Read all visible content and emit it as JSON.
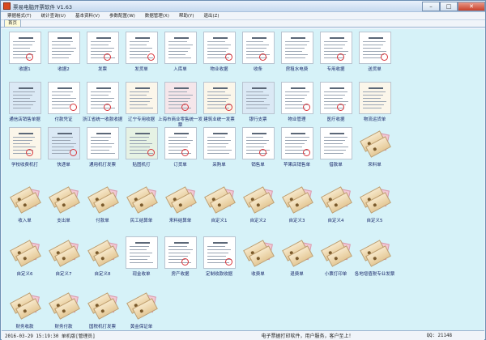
{
  "window": {
    "title": "票易电脑开票软件 V1.63",
    "min_icon": "minimize-icon",
    "max_icon": "maximize-icon",
    "close_icon": "close-icon"
  },
  "menu": [
    {
      "label": "票据格式(T)"
    },
    {
      "label": "统计查询(U)"
    },
    {
      "label": "基本资料(V)"
    },
    {
      "label": "参数配置(W)"
    },
    {
      "label": "数据管理(X)"
    },
    {
      "label": "帮助(Y)"
    },
    {
      "label": "退出(Z)"
    }
  ],
  "tabs": [
    {
      "label": "首页"
    }
  ],
  "tiles": [
    {
      "label": "收据1",
      "style": "doc"
    },
    {
      "label": "收据2",
      "style": "doc"
    },
    {
      "label": "发票",
      "style": "doc"
    },
    {
      "label": "发货单",
      "style": "doc"
    },
    {
      "label": "入库单",
      "style": "doc"
    },
    {
      "label": "物业收据",
      "style": "doc"
    },
    {
      "label": "收条",
      "style": "doc"
    },
    {
      "label": "房租水电费",
      "style": "doc"
    },
    {
      "label": "专用收据",
      "style": "doc"
    },
    {
      "label": "送货单",
      "style": "doc"
    },
    {
      "label": "通信店销售单据",
      "style": "doc-blue"
    },
    {
      "label": "付款凭证",
      "style": "doc"
    },
    {
      "label": "浙江省统一收款收据",
      "style": "doc"
    },
    {
      "label": "辽宁专用收据",
      "style": "doc-cream"
    },
    {
      "label": "上海市商业零售统一发票",
      "style": "doc-pink"
    },
    {
      "label": "建筑业统一发票",
      "style": "doc-cream"
    },
    {
      "label": "银行支票",
      "style": "doc-blue"
    },
    {
      "label": "物业管理",
      "style": "doc"
    },
    {
      "label": "医疗收据",
      "style": "doc"
    },
    {
      "label": "物流运货单",
      "style": "doc-cream"
    },
    {
      "label": "学校收费机打",
      "style": "doc-cream"
    },
    {
      "label": "快递单",
      "style": "doc-blue"
    },
    {
      "label": "通用机打发票",
      "style": "doc"
    },
    {
      "label": "贴图机打",
      "style": "doc-green"
    },
    {
      "label": "订货单",
      "style": "doc"
    },
    {
      "label": "采购单",
      "style": "doc"
    },
    {
      "label": "销售单",
      "style": "doc"
    },
    {
      "label": "苹果店销售单",
      "style": "doc"
    },
    {
      "label": "借款单",
      "style": "doc"
    },
    {
      "label": "来料单",
      "style": "ticket"
    },
    {
      "label": "收入单",
      "style": "ticket"
    },
    {
      "label": "支出单",
      "style": "ticket"
    },
    {
      "label": "付款单",
      "style": "ticket"
    },
    {
      "label": "民工结算单",
      "style": "ticket"
    },
    {
      "label": "来料结算单",
      "style": "ticket"
    },
    {
      "label": "自定义1",
      "style": "ticket"
    },
    {
      "label": "自定义2",
      "style": "ticket"
    },
    {
      "label": "自定义3",
      "style": "ticket"
    },
    {
      "label": "自定义4",
      "style": "ticket"
    },
    {
      "label": "自定义5",
      "style": "ticket"
    },
    {
      "label": "自定义6",
      "style": "ticket"
    },
    {
      "label": "自定义7",
      "style": "ticket"
    },
    {
      "label": "自定义8",
      "style": "ticket"
    },
    {
      "label": "现金收单",
      "style": "doc"
    },
    {
      "label": "房产收据",
      "style": "doc"
    },
    {
      "label": "定制收款收据",
      "style": "doc"
    },
    {
      "label": "收费单",
      "style": "ticket"
    },
    {
      "label": "退费单",
      "style": "ticket"
    },
    {
      "label": "小票打印单",
      "style": "ticket"
    },
    {
      "label": "各地增值税专业发票",
      "style": "ticket"
    },
    {
      "label": "财务收款",
      "style": "ticket"
    },
    {
      "label": "财务付款",
      "style": "ticket"
    },
    {
      "label": "国税机打发票",
      "style": "ticket"
    },
    {
      "label": "黄金保证单",
      "style": "ticket"
    }
  ],
  "status": {
    "datetime": "2016-03-29 15:19:30",
    "edition": "单机版[管理员]",
    "slogan": "电子票据打印软件，用户服务，客户至上！",
    "qq": "QQ: 21148"
  }
}
